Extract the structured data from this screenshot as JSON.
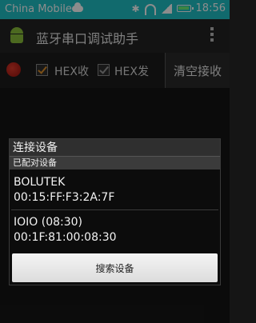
{
  "status_bar": {
    "carrier": "China Mobile",
    "time": "18:56"
  },
  "app": {
    "title": "蓝牙串口调试助手"
  },
  "toolbar": {
    "hex_receive_label": "HEX收",
    "hex_send_label": "HEX发",
    "clear_receive_label": "清空接收",
    "hex_receive_checked": true,
    "hex_send_checked": true
  },
  "dialog": {
    "title": "连接设备",
    "section": "已配对设备",
    "devices": [
      {
        "name": "BOLUTEK",
        "address": "00:15:FF:F3:2A:7F"
      },
      {
        "name": "IOIO (08:30)",
        "address": "00:1F:81:00:08:30"
      }
    ],
    "search_button": "搜索设备"
  },
  "colors": {
    "status_bar": "#1fc1c6",
    "accent": "#e0912a"
  }
}
